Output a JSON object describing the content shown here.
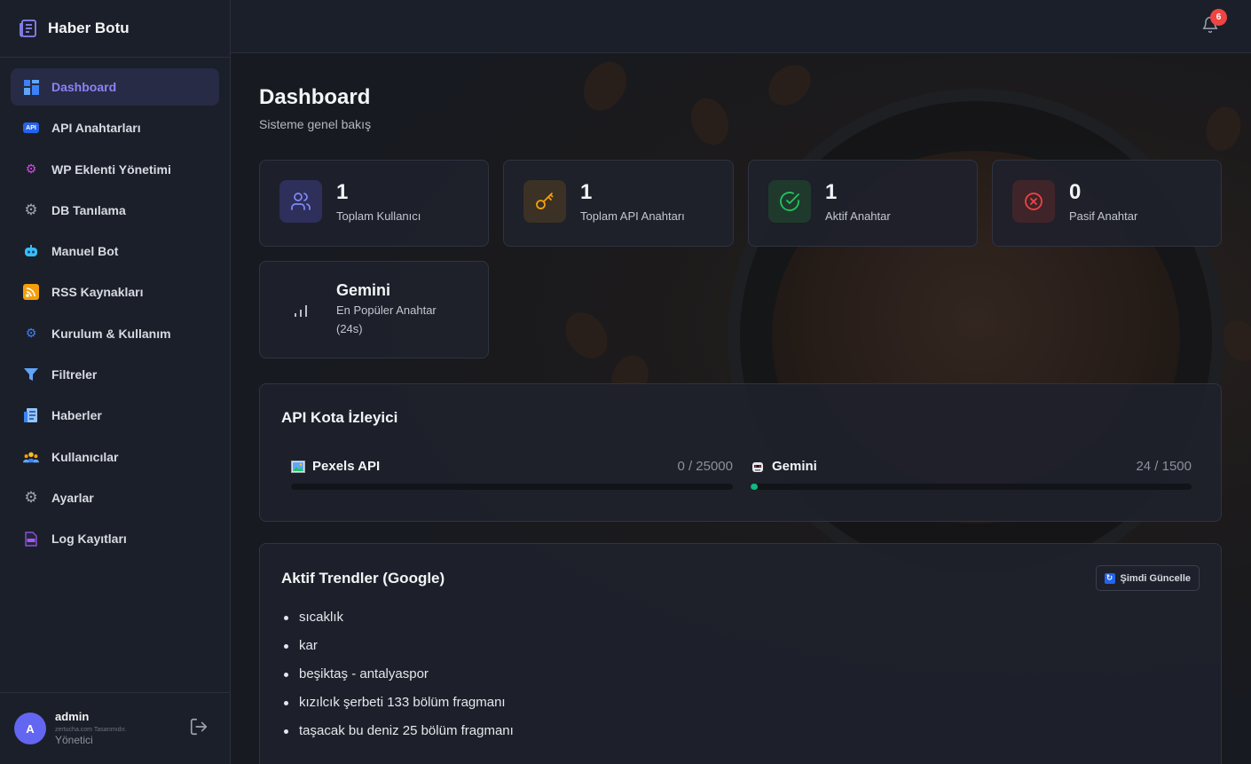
{
  "app": {
    "title": "Haber Botu"
  },
  "sidebar": {
    "items": [
      {
        "label": "Dashboard",
        "icon": "dashboard-icon",
        "active": true
      },
      {
        "label": "API Anahtarları",
        "icon": "api-icon"
      },
      {
        "label": "WP Eklenti Yönetimi",
        "icon": "plugin-gears-icon"
      },
      {
        "label": "DB Tanılama",
        "icon": "gear-icon"
      },
      {
        "label": "Manuel Bot",
        "icon": "robot-icon"
      },
      {
        "label": "RSS Kaynakları",
        "icon": "rss-icon"
      },
      {
        "label": "Kurulum & Kullanım",
        "icon": "setup-gears-icon"
      },
      {
        "label": "Filtreler",
        "icon": "filter-icon"
      },
      {
        "label": "Haberler",
        "icon": "newspaper-icon"
      },
      {
        "label": "Kullanıcılar",
        "icon": "users-icon"
      },
      {
        "label": "Ayarlar",
        "icon": "settings-icon"
      },
      {
        "label": "Log Kayıtları",
        "icon": "log-file-icon"
      }
    ],
    "user": {
      "initial": "A",
      "name": "admin",
      "credit": "zertucha.com Tasarımıdır.",
      "role": "Yönetici"
    }
  },
  "topbar": {
    "notification_count": "6"
  },
  "page": {
    "title": "Dashboard",
    "subtitle": "Sisteme genel bakış"
  },
  "stats": [
    {
      "value": "1",
      "label": "Toplam Kullanıcı",
      "icon": "users-icon",
      "color": "#6366f1"
    },
    {
      "value": "1",
      "label": "Toplam API Anahtarı",
      "icon": "key-icon",
      "color": "#f59e0b"
    },
    {
      "value": "1",
      "label": "Aktif Anahtar",
      "icon": "check-circle-icon",
      "color": "#22c55e"
    },
    {
      "value": "0",
      "label": "Pasif Anahtar",
      "icon": "x-circle-icon",
      "color": "#ef4444"
    }
  ],
  "popular": {
    "value": "Gemini",
    "label_line1": "En Popüler Anahtar",
    "label_line2": "(24s)",
    "icon": "bar-chart-icon"
  },
  "quota": {
    "title": "API Kota İzleyici",
    "items": [
      {
        "name": "Pexels API",
        "used": 0,
        "limit": 25000,
        "count": "0 / 25000",
        "icon": "picture-icon"
      },
      {
        "name": "Gemini",
        "used": 24,
        "limit": 1500,
        "count": "24 / 1500",
        "icon": "robot-face-icon"
      }
    ],
    "bar_color": "#10b981"
  },
  "trends": {
    "title": "Aktif Trendler (Google)",
    "refresh_label": "Şimdi Güncelle",
    "items": [
      "sıcaklık",
      "kar",
      "beşiktaş - antalyaspor",
      "kızılcık şerbeti 133 bölüm fragmanı",
      "taşacak bu deniz 25 bölüm fragmanı"
    ]
  }
}
